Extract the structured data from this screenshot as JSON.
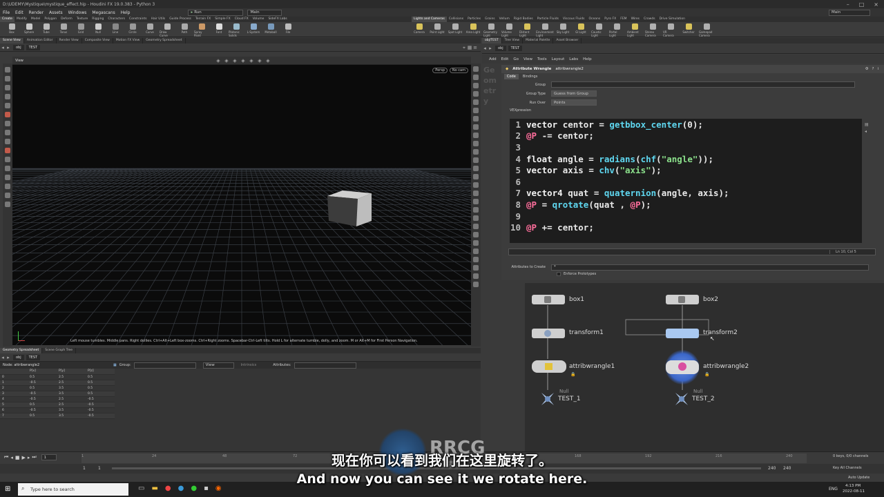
{
  "window": {
    "title": "D:\\UDEMY\\Mystique\\mystique_effect.hip - Houdini FX 19.0.383 - Python 3",
    "desktop": "Main"
  },
  "menu": [
    "File",
    "Edit",
    "Render",
    "Assets",
    "Windows",
    "Megascans",
    "Help"
  ],
  "run_combo": "Run",
  "main_combo": "Main",
  "shelf_tabs_left": [
    "Create",
    "Modify",
    "Model",
    "Polygon",
    "Deform",
    "Texture",
    "Rigging",
    "Characters",
    "Constraints",
    "Hair Utils",
    "Guide Process",
    "Terrain FX",
    "Simple FX",
    "Cloud FX",
    "Volume",
    "SideFX Labs"
  ],
  "shelf_tabs_right": [
    "Lights and Cameras",
    "Collisions",
    "Particles",
    "Grains",
    "Vellum",
    "Rigid Bodies",
    "Particle Fluids",
    "Viscous Fluids",
    "Oceans",
    "Pyro FX",
    "FEM",
    "Wires",
    "Crowds",
    "Drive Simulation"
  ],
  "shelf_tools_left": [
    "Box",
    "Sphere",
    "Tube",
    "Torus",
    "Grid",
    "Null",
    "Line",
    "Circle",
    "Curve",
    "Draw Curve",
    "Path",
    "Spray Paint",
    "Font",
    "Platonic Solids",
    "L-System",
    "Metaball",
    "File"
  ],
  "shelf_tools_right": [
    "Camera",
    "Point Light",
    "Spot Light",
    "Area Light",
    "Geometry Light",
    "Volume Light",
    "Distant Light",
    "Environment Light",
    "Sky Light",
    "GI Light",
    "Caustic Light",
    "Portal Light",
    "Ambient Light",
    "Stereo Camera",
    "VR Camera",
    "Switcher",
    "Gamepad Camera"
  ],
  "left_pane": {
    "tabs": [
      "Scene View",
      "Animation Editor",
      "Render View",
      "Composite View",
      "Motion FX View",
      "Geometry Spreadsheet"
    ],
    "path": [
      "obj",
      "TEST"
    ],
    "view_label": "View",
    "persp": "Persp",
    "cam": "No cam",
    "hint": "Left mouse tumbles. Middle pans. Right dollies. Ctrl+Alt+Left box-zooms. Ctrl+Right zooms. Spacebar-Ctrl-Left tilts. Hold L for alternate tumble, dolly, and zoom.    M or Alt+M for First Person Navigation."
  },
  "spreadsheet": {
    "tabs": [
      "Geometry Spreadsheet",
      "Scene Graph Tree"
    ],
    "path": [
      "obj",
      "TEST"
    ],
    "node": "Node: attribwrangle2",
    "group_label": "Group:",
    "view_label": "View",
    "intrinsics_label": "Intrinsics",
    "attributes_label": "Attributes:",
    "headers": [
      "",
      "P[x]",
      "P[y]",
      "P[z]"
    ],
    "rows": [
      [
        "0",
        "0.5",
        "2.5",
        "0.5"
      ],
      [
        "1",
        "-0.5",
        "2.5",
        "0.5"
      ],
      [
        "2",
        "0.5",
        "3.5",
        "0.5"
      ],
      [
        "3",
        "-0.5",
        "3.5",
        "0.5"
      ],
      [
        "4",
        "-0.5",
        "2.5",
        "-0.5"
      ],
      [
        "5",
        "0.5",
        "2.5",
        "-0.5"
      ],
      [
        "6",
        "-0.5",
        "3.5",
        "-0.5"
      ],
      [
        "7",
        "0.5",
        "3.5",
        "-0.5"
      ]
    ]
  },
  "right_pane": {
    "tabs": [
      "obj/TEST",
      "Tree View",
      "Material Palette",
      "Asset Browser"
    ],
    "path": [
      "obj",
      "TEST"
    ],
    "menu": [
      "Add",
      "Edit",
      "Go",
      "View",
      "Tools",
      "Layout",
      "Labs",
      "Help"
    ],
    "node_type": "Attribute Wrangle",
    "node_name": "attribwrangle2",
    "param_tabs": [
      "Code",
      "Bindings"
    ],
    "group_label": "Group",
    "group_type_label": "Group Type",
    "group_type_value": "Guess from Group",
    "run_over_label": "Run Over",
    "run_over_value": "Points",
    "vex_label": "VEXpression",
    "cursor_pos": "Ln 10, Col 5",
    "attrs_create_label": "Attributes to Create",
    "attrs_create_value": "*",
    "enforce_label": "Enforce Prototypes",
    "geo_letters": [
      "Ge",
      "om",
      "etr",
      "y"
    ]
  },
  "code_lines": [
    {
      "n": "1",
      "parts": [
        [
          "k",
          "vector "
        ],
        [
          "t",
          "centor = "
        ],
        [
          "f",
          "getbbox_center"
        ],
        [
          "t",
          "(0);"
        ]
      ]
    },
    {
      "n": "2",
      "parts": [
        [
          "v",
          "@P"
        ],
        [
          "t",
          " -= centor;"
        ]
      ]
    },
    {
      "n": "3",
      "parts": []
    },
    {
      "n": "4",
      "parts": [
        [
          "k",
          "float "
        ],
        [
          "t",
          "angle = "
        ],
        [
          "f",
          "radians"
        ],
        [
          "t",
          "("
        ],
        [
          "f",
          "chf"
        ],
        [
          "t",
          "("
        ],
        [
          "s",
          "\"angle\""
        ],
        [
          "t",
          "));"
        ]
      ]
    },
    {
      "n": "5",
      "parts": [
        [
          "k",
          "vector "
        ],
        [
          "t",
          "axis = "
        ],
        [
          "f",
          "chv"
        ],
        [
          "t",
          "("
        ],
        [
          "s",
          "\"axis\""
        ],
        [
          "t",
          ");"
        ]
      ]
    },
    {
      "n": "6",
      "parts": []
    },
    {
      "n": "7",
      "parts": [
        [
          "k",
          "vector4 "
        ],
        [
          "t",
          "quat = "
        ],
        [
          "f",
          "quaternion"
        ],
        [
          "t",
          "(angle, axis);"
        ]
      ]
    },
    {
      "n": "8",
      "parts": [
        [
          "v",
          "@P"
        ],
        [
          "t",
          " = "
        ],
        [
          "f",
          "qrotate"
        ],
        [
          "t",
          "(quat , "
        ],
        [
          "v",
          "@P"
        ],
        [
          "t",
          ");"
        ]
      ]
    },
    {
      "n": "9",
      "parts": []
    },
    {
      "n": "10",
      "parts": [
        [
          "v",
          "@P"
        ],
        [
          "t",
          " += centor;"
        ]
      ]
    }
  ],
  "network_nodes": {
    "box1": "box1",
    "box2": "box2",
    "transform1": "transform1",
    "transform2": "transform2",
    "attribwrangle1": "attribwrangle1",
    "attribwrangle2": "attribwrangle2",
    "null_tag": "Null",
    "test1": "TEST_1",
    "test2": "TEST_2"
  },
  "timeline": {
    "frame": "1",
    "start": "1",
    "start2": "1",
    "ticks": [
      "1",
      "24",
      "48",
      "72",
      "96",
      "120",
      "144",
      "168",
      "192",
      "216",
      "240"
    ],
    "end": "240",
    "end2": "240",
    "keys": "0 keys, 0/0 channels",
    "key_all": "Key All Channels",
    "auto_update": "Auto Update"
  },
  "subtitles": {
    "zh": "现在你可以看到我们在这里旋转了。",
    "en": "And now you can see it we rotate here."
  },
  "taskbar": {
    "search": "Type here to search",
    "lang": "ENG",
    "time": "4:13 PM",
    "date": "2022-08-11"
  },
  "watermark": {
    "text": "RRCG",
    "sub": "人人素材"
  },
  "colors": {
    "code_bg": "#1d1d1d",
    "func": "#5fd7f0",
    "string": "#8be08b",
    "attr": "#ff6e9c",
    "selected_node": "#a9c8f0"
  }
}
